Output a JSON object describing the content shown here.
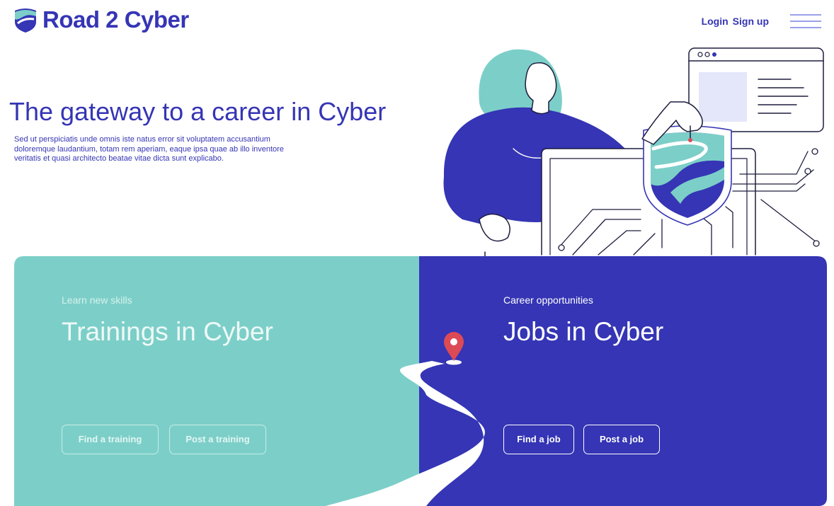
{
  "header": {
    "brand": "Road 2 Cyber",
    "logo_icon": "road-shield-icon",
    "login_label": "Login",
    "signup_label": "Sign up",
    "menu_icon": "hamburger-menu-icon"
  },
  "hero": {
    "title": "The gateway to a career in Cyber",
    "description": "Sed ut perspiciatis unde omnis iste natus error sit voluptatem accusantium doloremque laudantium, totam rem aperiam, eaque ipsa quae ab illo inventore veritatis et quasi architecto beatae vitae dicta sunt explicabo."
  },
  "trainings": {
    "kicker": "Learn new skills",
    "title": "Trainings in Cyber",
    "find_label": "Find a training",
    "post_label": "Post a training"
  },
  "jobs": {
    "kicker": "Career opportunities",
    "title": "Jobs in Cyber",
    "find_label": "Find a job",
    "post_label": "Post a job"
  },
  "colors": {
    "brand_blue": "#3535b5",
    "teal": "#7ccfc8",
    "pin_red": "#dc4a55",
    "background": "#ffffff"
  }
}
